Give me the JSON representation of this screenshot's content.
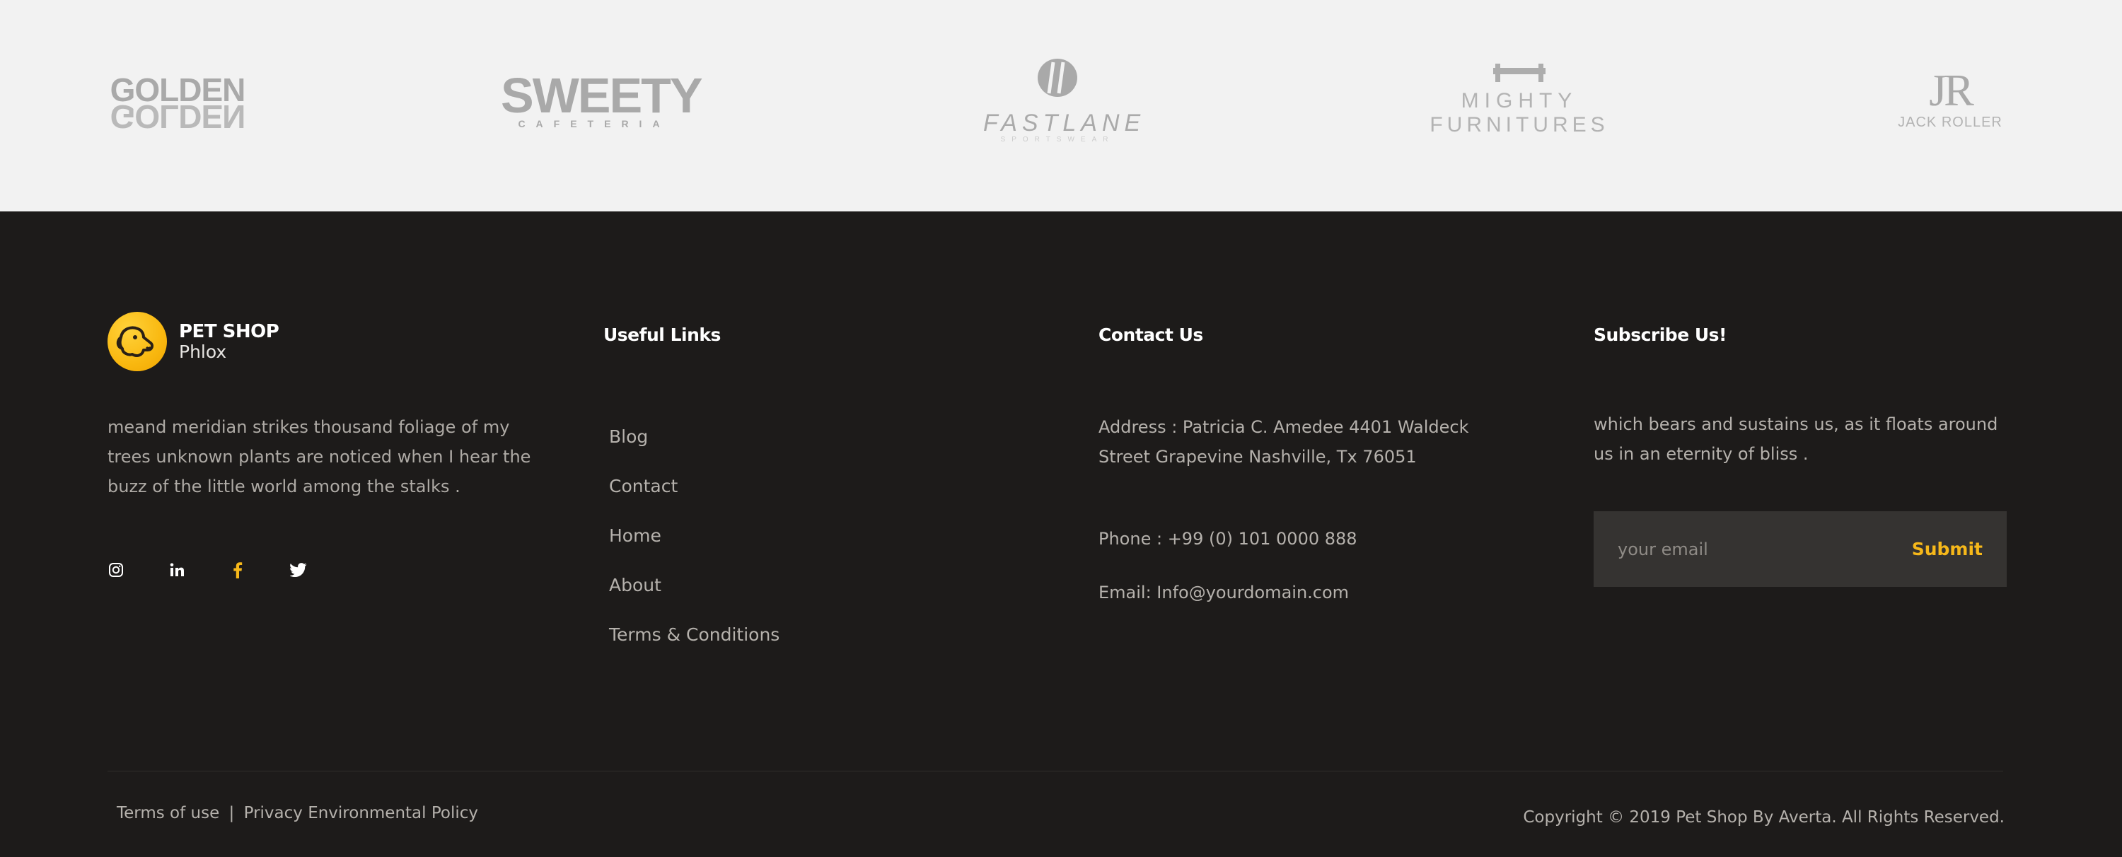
{
  "brands": {
    "golden": {
      "line1": "GOLDEN",
      "line2": "GOLDEN"
    },
    "sweety": {
      "name": "SWEETY",
      "sub": "CAFETERIA"
    },
    "fastlane": {
      "name": "FASTLANE",
      "sub": "SPORTSWEAR"
    },
    "mighty": {
      "line1": "MIGHTY",
      "line2": "FURNITURES"
    },
    "jack": {
      "monogram": "JR",
      "name": "JACK ROLLER"
    }
  },
  "footer": {
    "logo": {
      "title": "PET SHOP",
      "subtitle": "Phlox",
      "icon": "dog-face-icon"
    },
    "about_text": "meand meridian strikes thousand foliage of my trees unknown plants are noticed when I hear the buzz of the little world among the stalks .",
    "social": [
      "instagram-icon",
      "linkedin-icon",
      "facebook-icon",
      "twitter-icon"
    ],
    "useful_links": {
      "title": "Useful Links",
      "items": [
        "Blog",
        "Contact",
        "Home",
        "About",
        "Terms & Conditions"
      ]
    },
    "contact": {
      "title": "Contact Us",
      "address": "Address : Patricia C. Amedee 4401 Waldeck Street Grapevine Nashville, Tx 76051",
      "phone": "Phone : +99 (0) 101 0000 888",
      "email": "Email: Info@yourdomain.com"
    },
    "subscribe": {
      "title": "Subscribe Us!",
      "text": "which bears and sustains us, as it floats around us in an eternity of bliss .",
      "placeholder": "your email",
      "button": "Submit"
    },
    "bottom": {
      "terms": "Terms of use",
      "separator": "|",
      "privacy": "Privacy Environmental Policy",
      "copyright": "Copyright © 2019 Pet Shop By Averta. All Rights Reserved."
    },
    "colors": {
      "background": "#1d1b1a",
      "accent": "#f6b81a",
      "input_bg": "#353331"
    }
  }
}
